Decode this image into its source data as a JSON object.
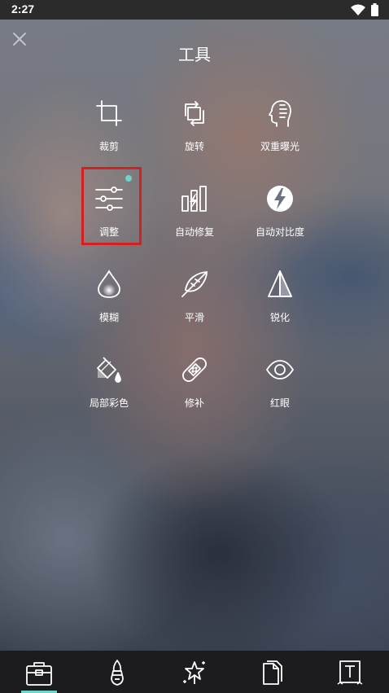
{
  "status_bar": {
    "time": "2:27"
  },
  "header": {
    "title": "工具"
  },
  "tools": [
    {
      "label": "裁剪",
      "icon": "crop-icon"
    },
    {
      "label": "旋转",
      "icon": "rotate-icon"
    },
    {
      "label": "双重曝光",
      "icon": "double-exposure-icon"
    },
    {
      "label": "调整",
      "icon": "adjust-sliders-icon",
      "badge": "new-dot"
    },
    {
      "label": "自动修复",
      "icon": "auto-fix-icon"
    },
    {
      "label": "自动对比度",
      "icon": "auto-contrast-icon"
    },
    {
      "label": "模糊",
      "icon": "blur-drop-icon"
    },
    {
      "label": "平滑",
      "icon": "smooth-feather-icon"
    },
    {
      "label": "锐化",
      "icon": "sharpen-prism-icon"
    },
    {
      "label": "局部彩色",
      "icon": "color-splash-bucket-icon"
    },
    {
      "label": "修补",
      "icon": "heal-bandage-icon"
    },
    {
      "label": "红眼",
      "icon": "red-eye-icon"
    }
  ],
  "bottom_nav": [
    {
      "name": "tools",
      "icon": "toolbox-icon",
      "active": true
    },
    {
      "name": "effects",
      "icon": "brush-icon",
      "active": false
    },
    {
      "name": "magic",
      "icon": "sparkle-star-icon",
      "active": false
    },
    {
      "name": "stickers",
      "icon": "sticker-pages-icon",
      "active": false
    },
    {
      "name": "text",
      "icon": "text-icon",
      "active": false
    }
  ],
  "colors": {
    "accent": "#6fd3c8",
    "highlight": "#d42020",
    "status_bar": "#2b2b2b",
    "bottom_nav": "#1c1c1e"
  }
}
